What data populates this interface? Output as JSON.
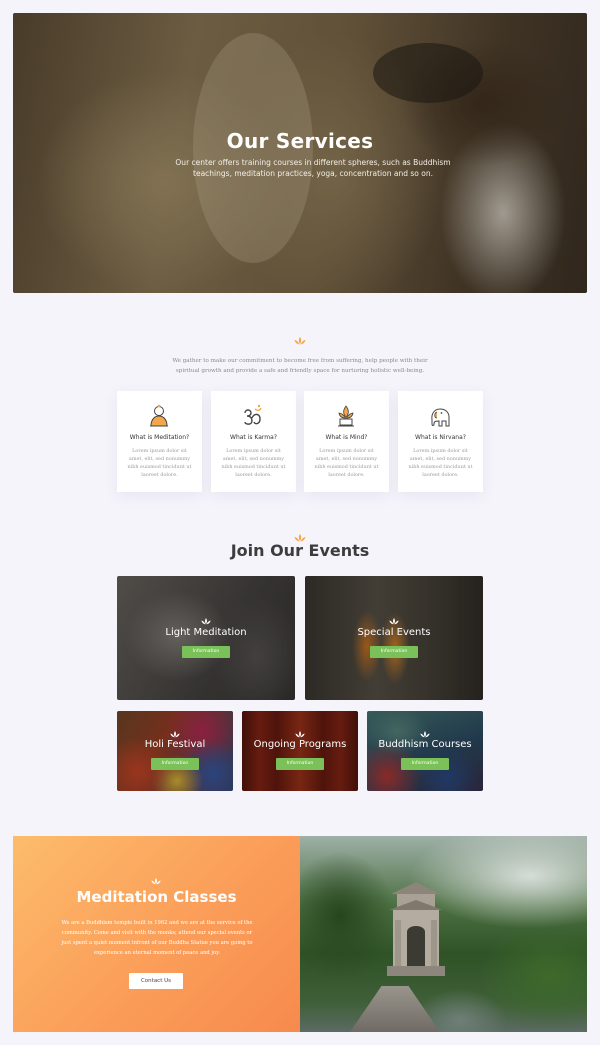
{
  "hero": {
    "title": "Our Services",
    "subtitle": "Our center offers training courses in different spheres, such as Buddhism teachings, meditation practices, yoga, concentration and so on."
  },
  "intro": {
    "text": "We gather to make our commitment to become free from suffering, help people with their spiritual growth and provide a safe and friendly space for nurturing holistic well-being."
  },
  "cards": [
    {
      "title": "What is Meditation?",
      "icon": "buddha-icon",
      "text": "Lorem ipsum dolor sit amet, elit, sed nonummy nibh euismod tincidunt ut laoreet dolore."
    },
    {
      "title": "What is Karma?",
      "icon": "om-icon",
      "text": "Lorem ipsum dolor sit amet, elit, sed nonummy nibh euismod tincidunt ut laoreet dolore."
    },
    {
      "title": "What is Mind?",
      "icon": "lotus-candle-icon",
      "text": "Lorem ipsum dolor sit amet, elit, sed nonummy nibh euismod tincidunt ut laoreet dolore."
    },
    {
      "title": "What is Nirvana?",
      "icon": "elephant-icon",
      "text": "Lorem ipsum dolor sit amet, elit, sed nonummy nibh euismod tincidunt ut laoreet dolore."
    }
  ],
  "events": {
    "title": "Join Our Events",
    "button_label": "Information",
    "items": [
      {
        "label": "Light Meditation"
      },
      {
        "label": "Special Events"
      },
      {
        "label": "Holi Festival"
      },
      {
        "label": "Ongoing Programs"
      },
      {
        "label": "Buddhism Courses"
      }
    ]
  },
  "meditation": {
    "title": "Meditation Classes",
    "text": "We are a Buddhism temple built in 1962 and we are at the service of the community. Come and visit with the monks; attend our special events or just spent a quiet moment infront of our Buddha Statue you are going to experience an eternal moment of peace and joy.",
    "button_label": "Contact Us"
  },
  "colors": {
    "accent": "#f3a64a",
    "button_green": "#7bc15a",
    "page_bg": "#f5f4fb"
  }
}
